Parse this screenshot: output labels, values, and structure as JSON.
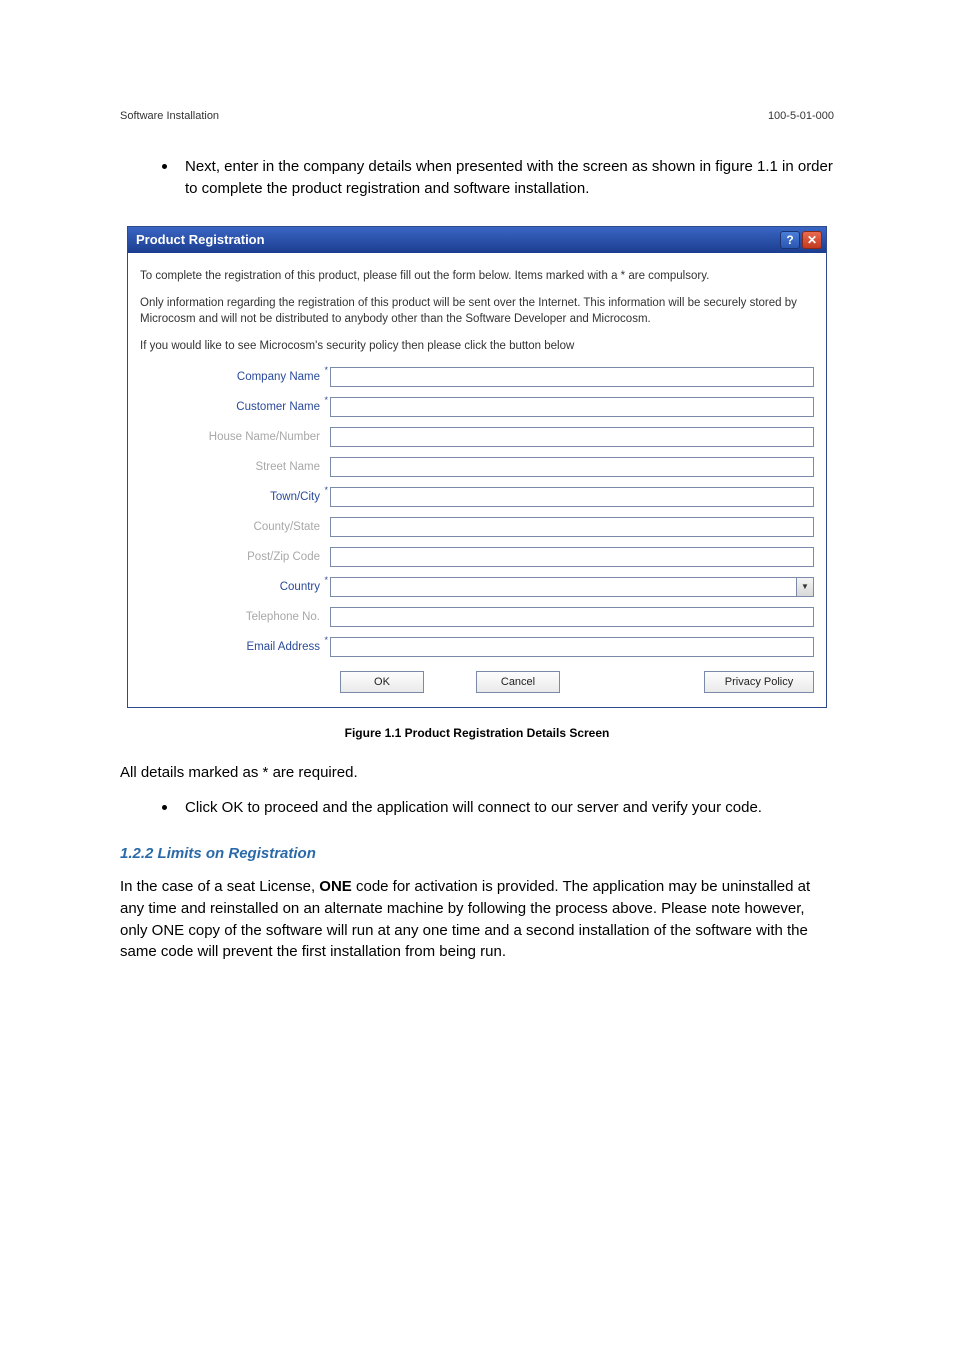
{
  "header": {
    "left": "Software Installation",
    "right": "100-5-01-000"
  },
  "intro_bullet": "Next, enter in the company details when presented with the screen as shown in figure 1.1 in order to complete the product registration and software installation.",
  "dialog": {
    "title": "Product Registration",
    "help_glyph": "?",
    "close_glyph": "✕",
    "p1": "To complete the registration of this product, please fill out the form below. Items marked with a * are compulsory.",
    "p2": "Only information regarding the registration of this product will be sent over the Internet. This information will be securely stored by Microcosm and will not be distributed to anybody other than the Software Developer and Microcosm.",
    "p3": "If you would like to see Microcosm's security policy then please click the button below",
    "fields": {
      "company": {
        "label": "Company Name",
        "required": true,
        "dim": false,
        "value": ""
      },
      "customer": {
        "label": "Customer Name",
        "required": true,
        "dim": false,
        "value": ""
      },
      "house": {
        "label": "House Name/Number",
        "required": false,
        "dim": true,
        "value": ""
      },
      "street": {
        "label": "Street Name",
        "required": false,
        "dim": true,
        "value": ""
      },
      "town": {
        "label": "Town/City",
        "required": true,
        "dim": false,
        "value": ""
      },
      "county": {
        "label": "County/State",
        "required": false,
        "dim": true,
        "value": ""
      },
      "postcode": {
        "label": "Post/Zip Code",
        "required": false,
        "dim": true,
        "value": ""
      },
      "country": {
        "label": "Country",
        "required": true,
        "dim": false,
        "value": ""
      },
      "telephone": {
        "label": "Telephone No.",
        "required": false,
        "dim": true,
        "value": ""
      },
      "email": {
        "label": "Email Address",
        "required": true,
        "dim": false,
        "value": ""
      }
    },
    "buttons": {
      "ok": "OK",
      "cancel": "Cancel",
      "privacy": "Privacy Policy"
    }
  },
  "caption": "Figure 1.1 Product Registration Details Screen",
  "req_note": "All details marked as * are required.",
  "bullet2": "Click OK to proceed and the application will connect to our server and verify your code.",
  "subhead": "1.2.2 Limits on Registration",
  "limits_para_pre": "In the case of a seat License, ",
  "limits_para_bold": "ONE",
  "limits_para_post": " code for activation is provided. The application may be uninstalled at any time and reinstalled on an alternate machine by following the process above.  Please note however, only ONE copy of the software will run at any one time and a second installation of the software with the same code will prevent the first installation from being run."
}
